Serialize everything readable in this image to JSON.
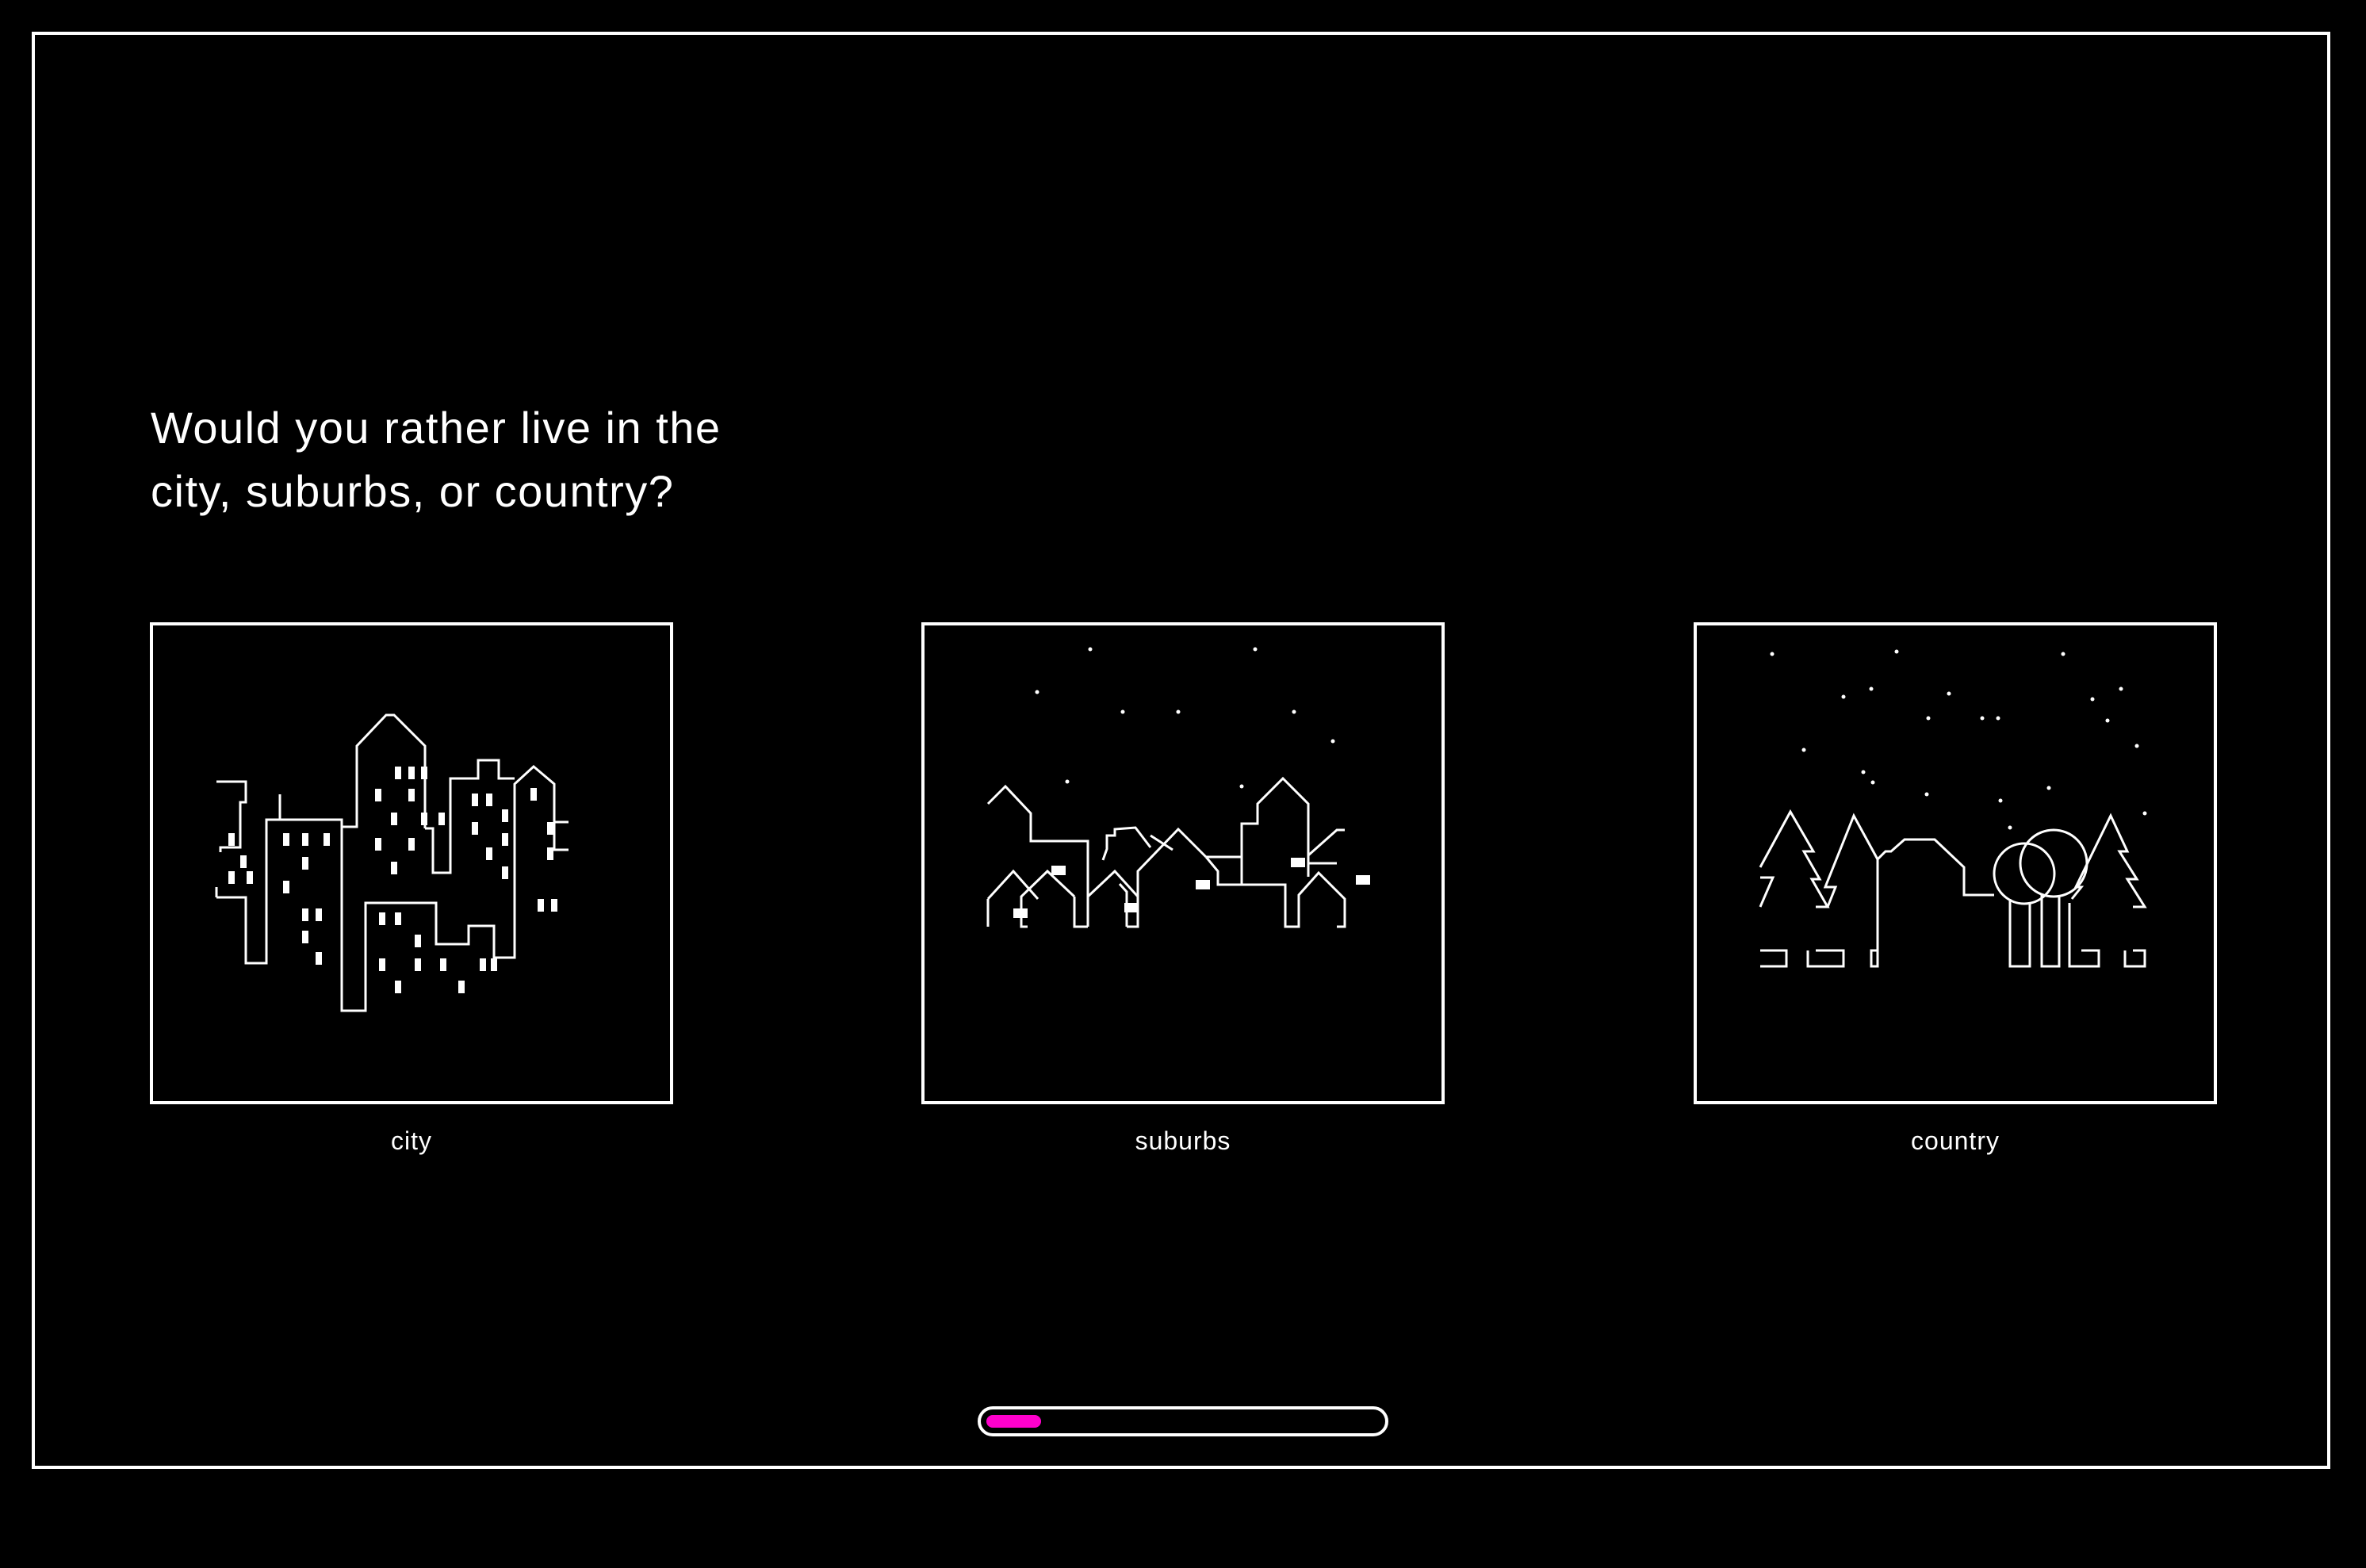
{
  "question": {
    "line1": "Would you rather live in the",
    "line2": "city, suburbs, or country?"
  },
  "options": [
    {
      "label": "city",
      "icon": "city-skyline-icon"
    },
    {
      "label": "suburbs",
      "icon": "suburb-houses-icon"
    },
    {
      "label": "country",
      "icon": "country-trees-icon"
    }
  ],
  "progress": {
    "fraction": 0.14,
    "color": "#ff00cc"
  },
  "colors": {
    "background": "#000000",
    "foreground": "#ffffff",
    "accent": "#ff00cc"
  }
}
